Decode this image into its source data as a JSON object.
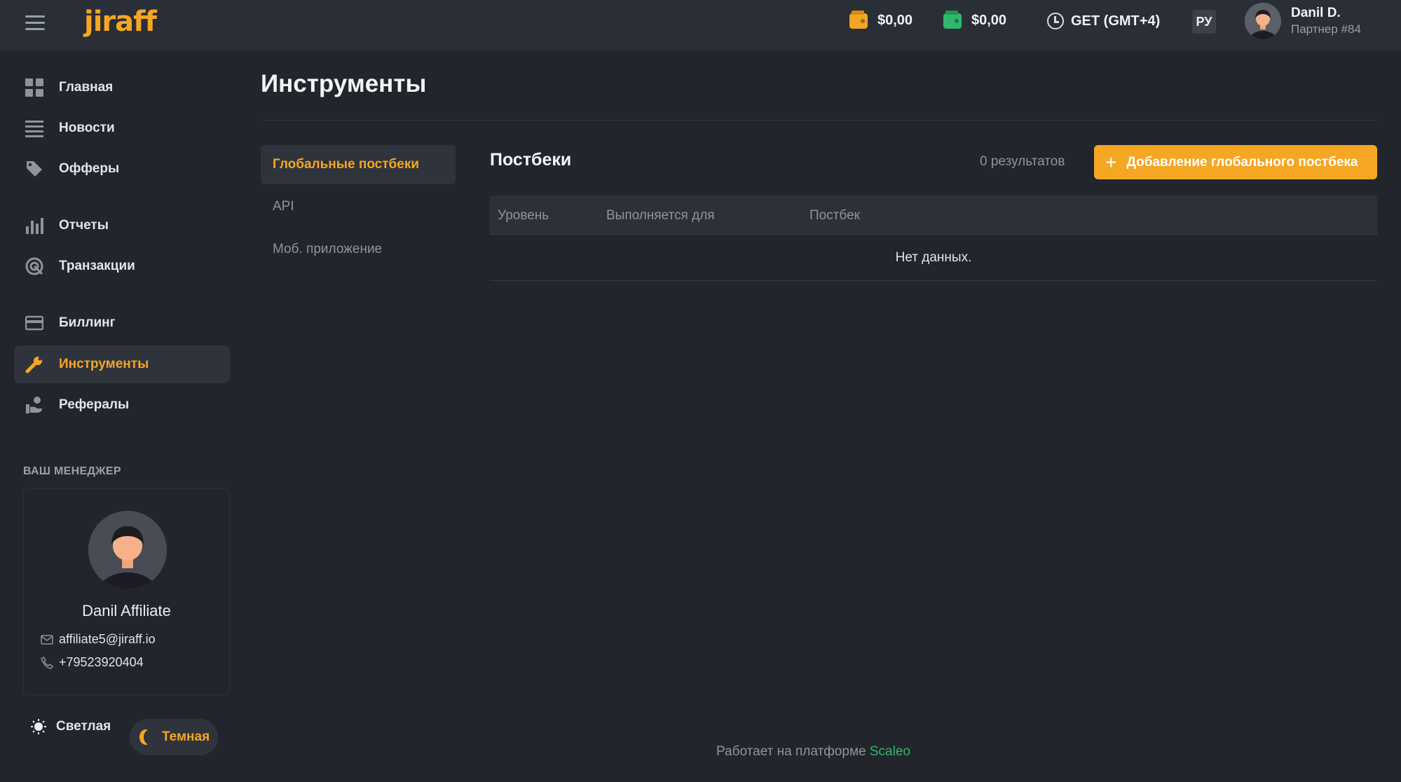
{
  "header": {
    "logo": "jiraff",
    "wallet1": "$0,00",
    "wallet2": "$0,00",
    "timezone": "GET (GMT+4)",
    "lang": "РУ",
    "user_name": "Danil D.",
    "user_sub": "Партнер #84"
  },
  "sidebar": {
    "items": [
      {
        "label": "Главная",
        "icon": "dashboard-icon"
      },
      {
        "label": "Новости",
        "icon": "news-icon"
      },
      {
        "label": "Офферы",
        "icon": "tag-icon"
      },
      {
        "label": "Отчеты",
        "icon": "bar-chart-icon"
      },
      {
        "label": "Транзакции",
        "icon": "transactions-icon"
      },
      {
        "label": "Биллинг",
        "icon": "credit-card-icon"
      },
      {
        "label": "Инструменты",
        "icon": "wrench-icon"
      },
      {
        "label": "Рефералы",
        "icon": "referral-icon"
      }
    ],
    "manager_title": "ВАШ МЕНЕДЖЕР",
    "manager": {
      "name": "Danil Affiliate",
      "email": "affiliate5@jiraff.io",
      "phone": "+79523920404"
    },
    "theme_light": "Светлая",
    "theme_dark": "Темная"
  },
  "main": {
    "title": "Инструменты",
    "subnav": [
      "Глобальные постбеки",
      "API",
      "Моб. приложение"
    ],
    "panel_title": "Постбеки",
    "results": "0  результатов",
    "add_button": "Добавление глобального постбека",
    "table": {
      "columns": [
        "Уровень",
        "Выполняется для",
        "Постбек"
      ],
      "empty": "Нет данных."
    }
  },
  "footer": {
    "text": "Работает на платформе",
    "brand": "Scaleo"
  },
  "colors": {
    "accent": "#f5a623",
    "success": "#2eb86b",
    "background": "#22252c",
    "topbar": "#2a2e36"
  }
}
